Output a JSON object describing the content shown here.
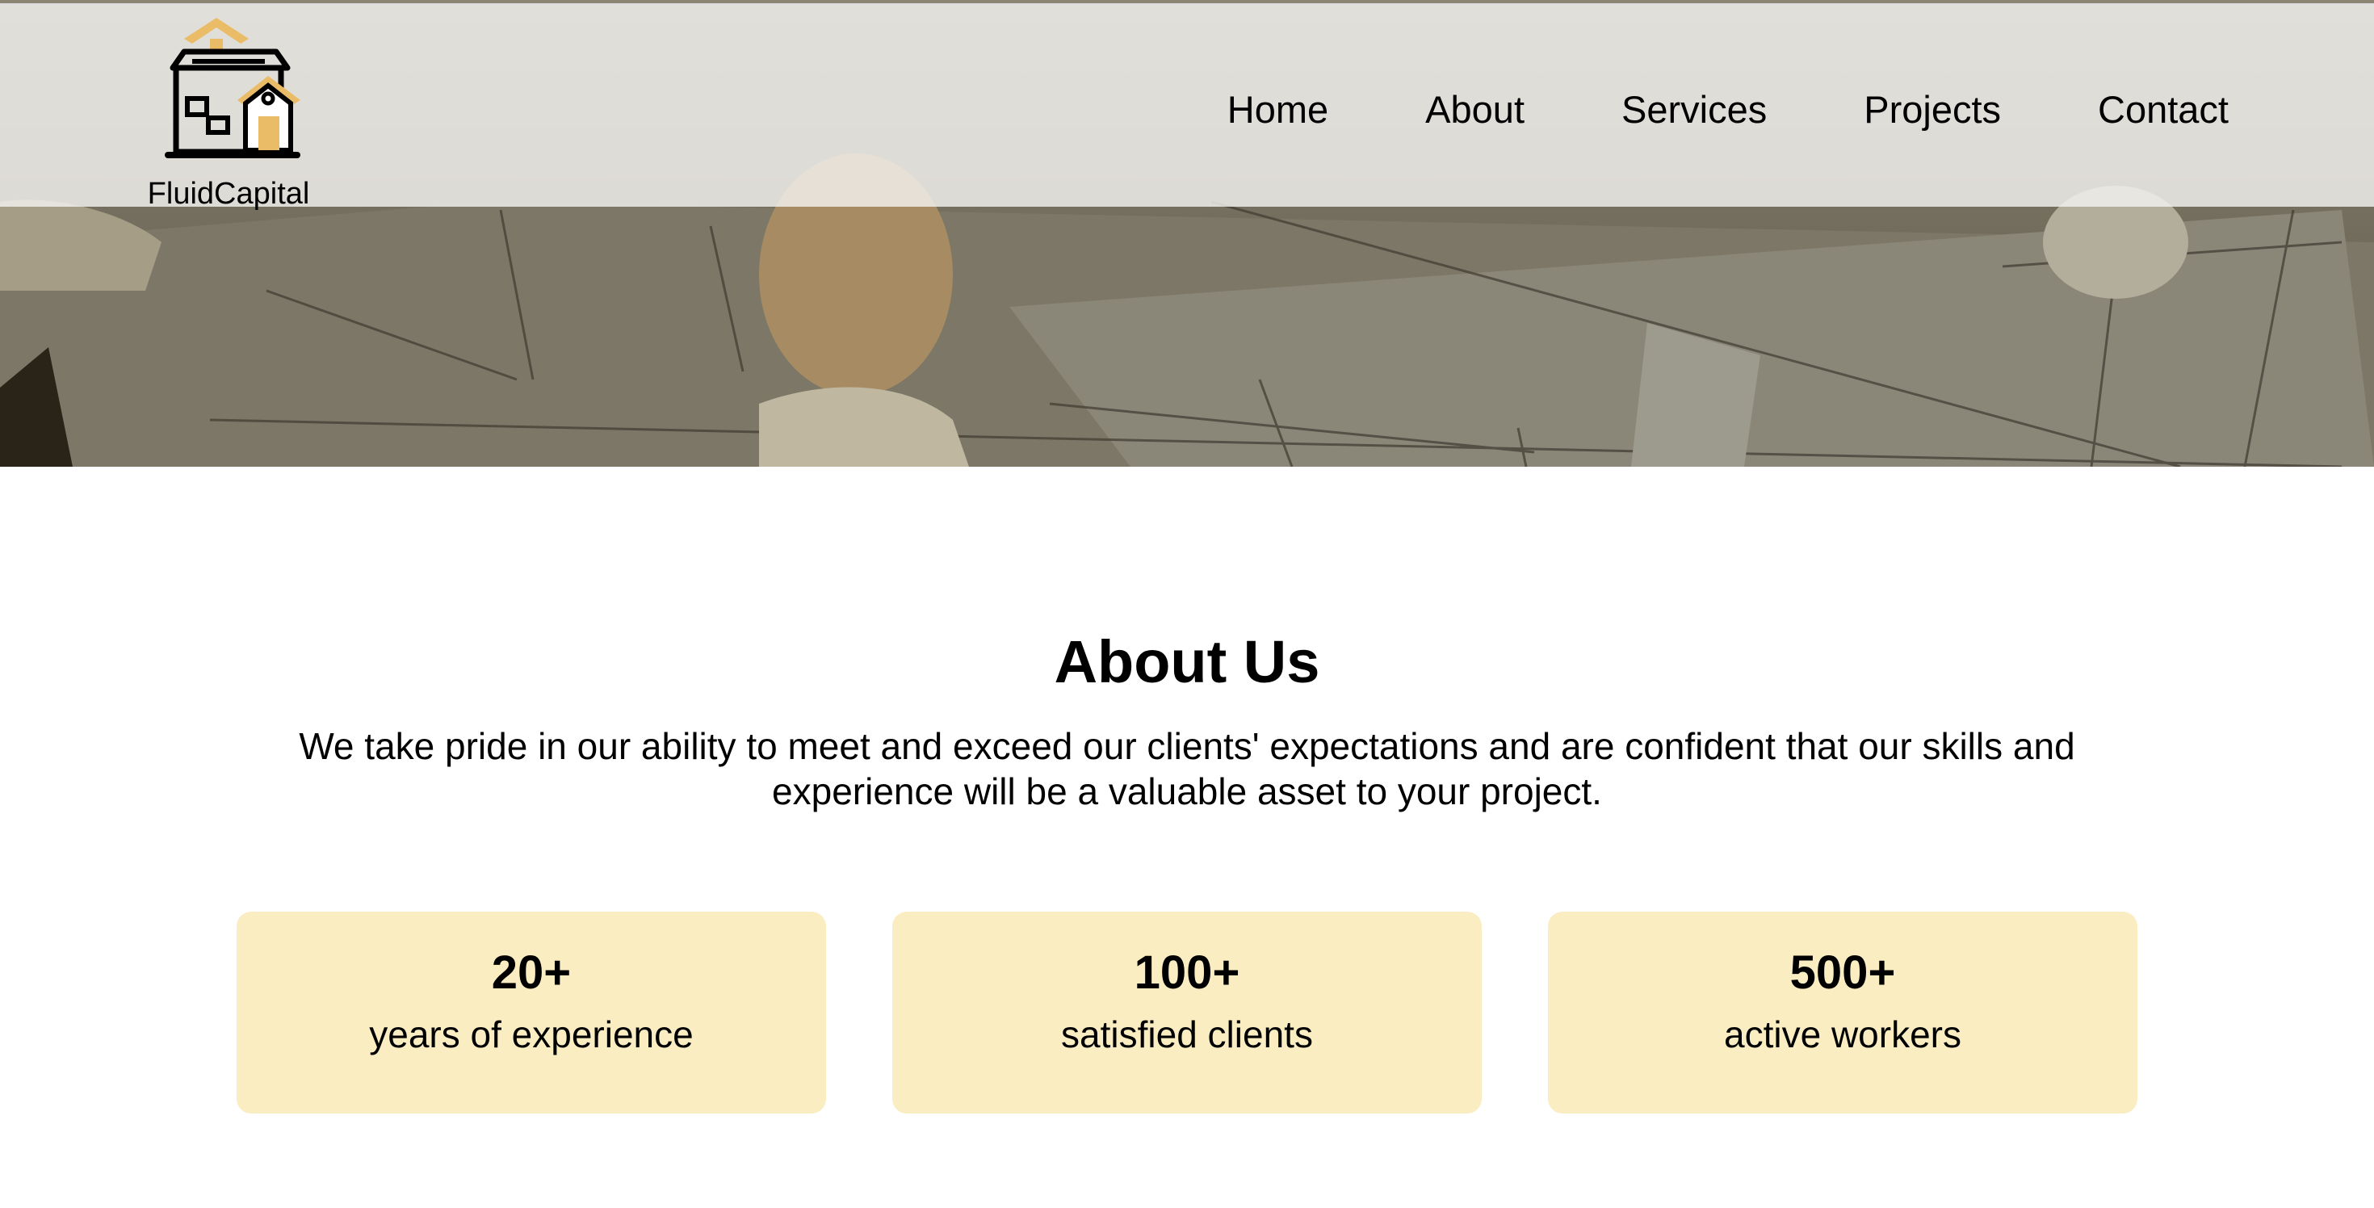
{
  "brand": {
    "name": "FluidCapital",
    "logo_icon": "house-icon",
    "accent_color": "#ebbc67"
  },
  "nav": {
    "items": [
      {
        "label": "Home"
      },
      {
        "label": "About"
      },
      {
        "label": "Services"
      },
      {
        "label": "Projects"
      },
      {
        "label": "Contact"
      }
    ]
  },
  "hero": {
    "image": "architectural-blueprint-photo"
  },
  "about": {
    "title": "About Us",
    "text": "We take pride in our ability to meet and exceed our clients' expectations and are confident that our skills and experience will be a valuable asset to your project."
  },
  "stats": [
    {
      "value": "20+",
      "label": "years of experience"
    },
    {
      "value": "100+",
      "label": "satisfied clients"
    },
    {
      "value": "500+",
      "label": "active workers"
    }
  ],
  "colors": {
    "stat_card_bg": "#fbedc2",
    "header_bg": "#f4f3f0"
  }
}
